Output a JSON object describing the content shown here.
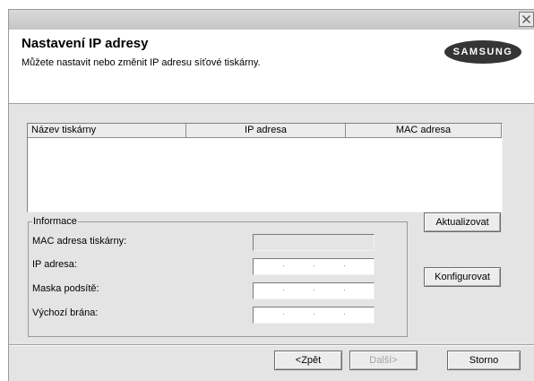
{
  "header": {
    "title": "Nastavení IP adresy",
    "subtitle": "Můžete nastavit nebo změnit IP adresu síťové tiskárny.",
    "logo_text": "SAMSUNG"
  },
  "printer_list": {
    "columns": [
      "Název tiskárny",
      "IP adresa",
      "MAC adresa"
    ],
    "rows": []
  },
  "info_group": {
    "legend": "Informace",
    "mac_label": "MAC adresa tiskárny:",
    "ip_label": "IP adresa:",
    "mask_label": "Maska podsítě:",
    "gateway_label": "Výchozí brána:"
  },
  "buttons": {
    "refresh": "Aktualizovat",
    "configure": "Konfigurovat",
    "back": "<Zpět",
    "next": "Další>",
    "cancel": "Storno"
  },
  "colors": {
    "dialog_bg": "#e4e4e4",
    "header_bg": "#ffffff",
    "logo_bg": "#353535"
  },
  "icons": {
    "close": "close-icon"
  }
}
